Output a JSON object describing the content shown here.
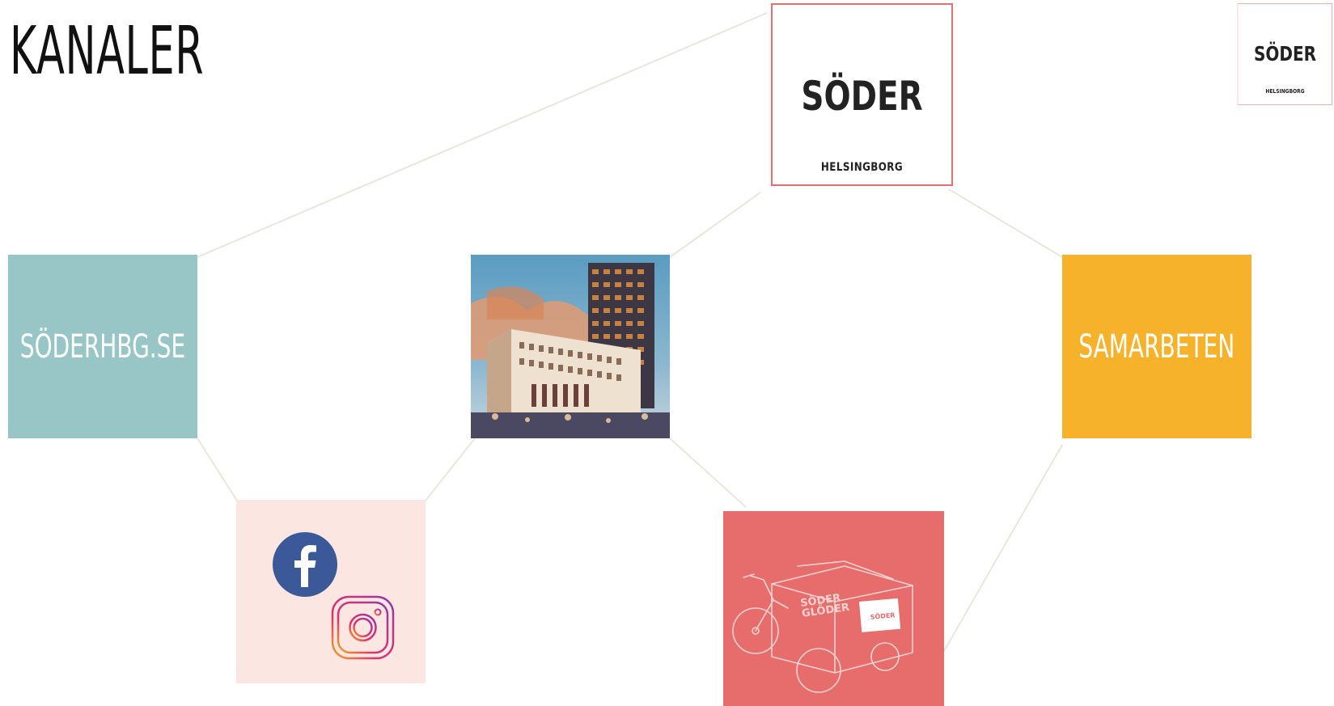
{
  "title": "KANALER",
  "logo": {
    "word": "SÖDER",
    "subtitle": "HELSINGBORG"
  },
  "nodes": {
    "web": {
      "label": "SÖDERHBG.SE",
      "color": "#98c5c6"
    },
    "collab": {
      "label": "SAMARBETEN",
      "color": "#f6b22b"
    },
    "social": {
      "color": "#fce6e1",
      "icons": [
        "facebook-icon",
        "instagram-icon"
      ]
    },
    "bike": {
      "color": "#e66d6c",
      "cart_text_1": "SÖDER",
      "cart_text_2": "GLÖDER",
      "box_text": "SÖDER"
    },
    "building": {
      "icon": "building-illustration"
    }
  },
  "colors": {
    "connector": "#e9e6dc",
    "logo_border": "#e36f72",
    "facebook": "#3b5998"
  }
}
